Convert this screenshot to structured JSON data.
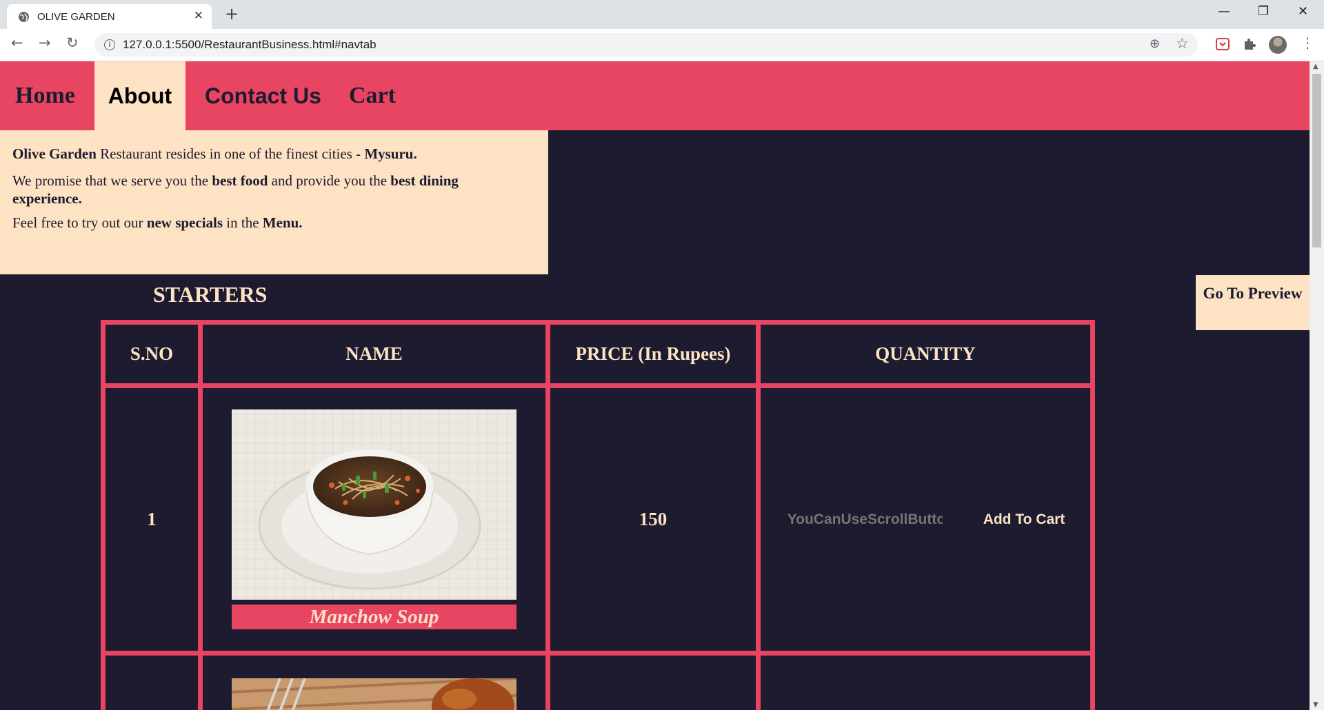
{
  "browser": {
    "tab_title": "OLIVE GARDEN",
    "url": "127.0.0.1:5500/RestaurantBusiness.html#navtab",
    "close_tab_glyph": "✕",
    "new_tab_glyph": "+",
    "minimize_glyph": "—",
    "maximize_glyph": "❐",
    "close_window_glyph": "✕",
    "back_glyph": "←",
    "forward_glyph": "→",
    "reload_glyph": "↻",
    "info_glyph": "i",
    "zoom_glyph": "⊕",
    "star_glyph": "☆",
    "menu_glyph": "⋮"
  },
  "nav": {
    "home": "Home",
    "about": "About",
    "contact": "Contact Us",
    "cart": "Cart"
  },
  "about": {
    "p1_bold_name": "Olive Garden",
    "p1_text": " Restaurant resides in one of the finest cities - ",
    "p1_bold_city": "Mysuru.",
    "p2_text_a": "We promise that we serve you the ",
    "p2_bold_a": "best food",
    "p2_text_b": " and provide you the ",
    "p2_bold_b": "best dining experience.",
    "p3_text_a": "Feel free to try out our ",
    "p3_bold_a": "new specials",
    "p3_text_b": " in the ",
    "p3_bold_b": "Menu."
  },
  "preview_button": "Go To Preview",
  "section": {
    "title": "STARTERS",
    "headers": {
      "sno": "S.NO",
      "name": "NAME",
      "price": "PRICE (In Rupees)",
      "quantity": "QUANTITY"
    },
    "items": [
      {
        "sno": "1",
        "name": "Manchow Soup",
        "price": "150",
        "qty_placeholder": "YouCanUseScrollButton",
        "add_label": "Add To Cart"
      }
    ]
  },
  "colors": {
    "accent": "#e84562",
    "background": "#1c1b2f",
    "cream": "#fde2c4"
  },
  "icons": {
    "favicon": "globe-icon",
    "extension1": "pocket-icon",
    "extension2": "puzzle-icon"
  }
}
